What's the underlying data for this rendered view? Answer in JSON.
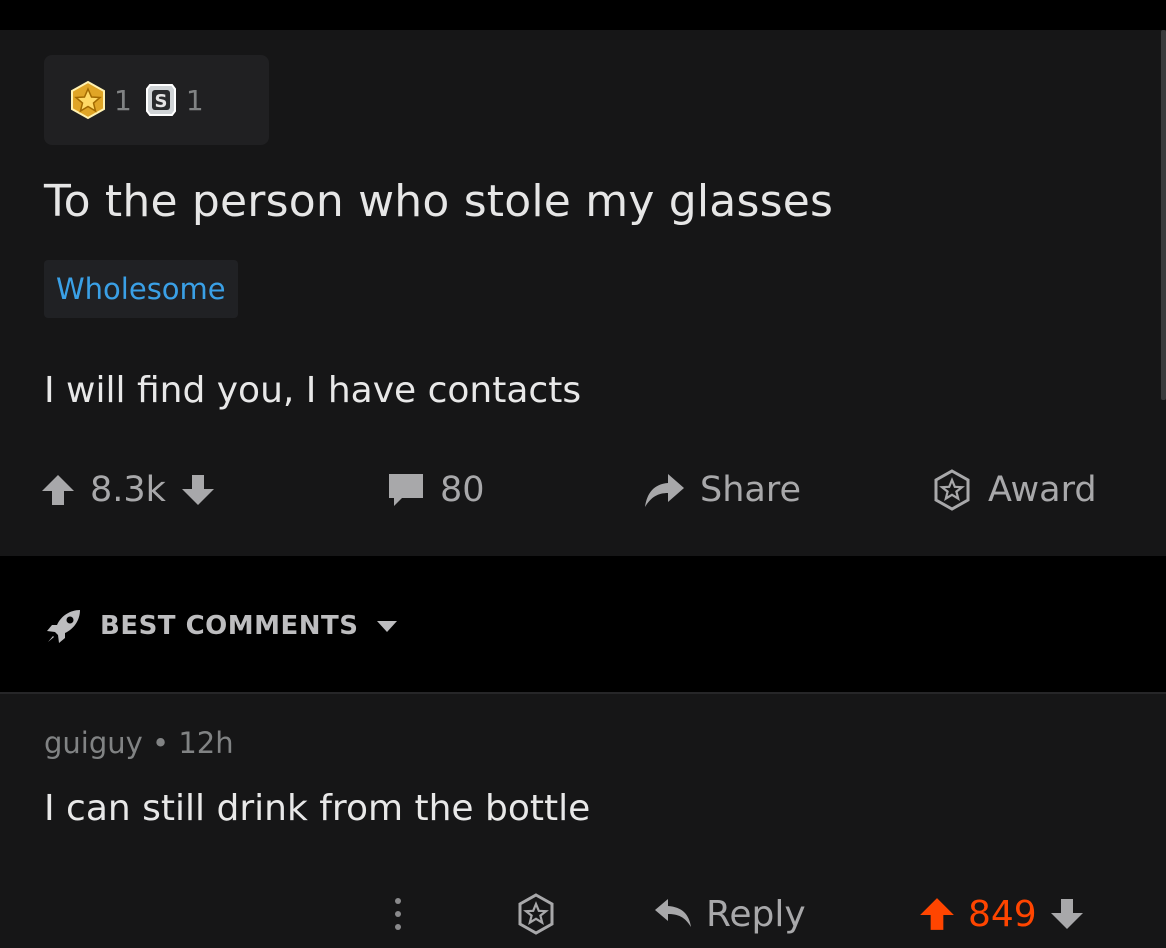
{
  "post": {
    "awards": [
      {
        "icon": "star-award-icon",
        "count": "1"
      },
      {
        "icon": "silver-award-icon",
        "count": "1"
      }
    ],
    "title": "To the person who stole my glasses",
    "flair": "Wholesome",
    "body": "I will find you, I have contacts",
    "actions": {
      "votes": "8.3k",
      "comments": "80",
      "share_label": "Share",
      "award_label": "Award"
    }
  },
  "comments_section": {
    "sort_label": "BEST COMMENTS"
  },
  "comment": {
    "author": "guiguy",
    "separator": "•",
    "age": "12h",
    "text": "I can still drink from the bottle",
    "reply_label": "Reply",
    "votes": "849"
  },
  "colors": {
    "background": "#161617",
    "flair_text": "#3aa0e6",
    "upvote_active": "#ff4500",
    "muted": "#818384"
  }
}
